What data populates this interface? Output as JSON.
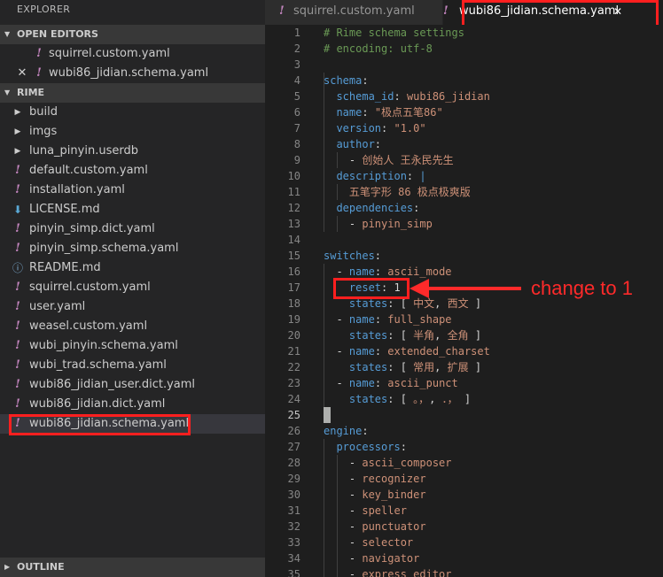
{
  "sidebar": {
    "title": "EXPLORER",
    "open_editors": {
      "label": "OPEN EDITORS",
      "items": [
        {
          "name": "squirrel.custom.yaml",
          "icon": "yaml-exclamation-icon"
        },
        {
          "name": "wubi86_jidian.schema.yaml",
          "icon": "yaml-exclamation-icon",
          "close_glyph": "✕"
        }
      ]
    },
    "folder": {
      "label": "RIME",
      "items": [
        {
          "name": "build",
          "icon": "chevron-right-icon"
        },
        {
          "name": "imgs",
          "icon": "chevron-right-icon"
        },
        {
          "name": "luna_pinyin.userdb",
          "icon": "chevron-right-icon"
        },
        {
          "name": "default.custom.yaml",
          "icon": "yaml-exclamation-icon"
        },
        {
          "name": "installation.yaml",
          "icon": "yaml-exclamation-icon"
        },
        {
          "name": "LICENSE.md",
          "icon": "download-arrow-icon"
        },
        {
          "name": "pinyin_simp.dict.yaml",
          "icon": "yaml-exclamation-icon"
        },
        {
          "name": "pinyin_simp.schema.yaml",
          "icon": "yaml-exclamation-icon"
        },
        {
          "name": "README.md",
          "icon": "info-icon"
        },
        {
          "name": "squirrel.custom.yaml",
          "icon": "yaml-exclamation-icon"
        },
        {
          "name": "user.yaml",
          "icon": "yaml-exclamation-icon"
        },
        {
          "name": "weasel.custom.yaml",
          "icon": "yaml-exclamation-icon"
        },
        {
          "name": "wubi_pinyin.schema.yaml",
          "icon": "yaml-exclamation-icon"
        },
        {
          "name": "wubi_trad.schema.yaml",
          "icon": "yaml-exclamation-icon"
        },
        {
          "name": "wubi86_jidian_user.dict.yaml",
          "icon": "yaml-exclamation-icon"
        },
        {
          "name": "wubi86_jidian.dict.yaml",
          "icon": "yaml-exclamation-icon"
        },
        {
          "name": "wubi86_jidian.schema.yaml",
          "icon": "yaml-exclamation-icon",
          "selected": true
        }
      ]
    },
    "outline_label": "OUTLINE"
  },
  "tabs": [
    {
      "label": "squirrel.custom.yaml",
      "active": false
    },
    {
      "label": "wubi86_jidian.schema.yaml",
      "active": true,
      "close_glyph": "✕"
    }
  ],
  "editor": {
    "active_line": 25,
    "lines": [
      {
        "n": "1",
        "tokens": [
          {
            "t": "# Rime schema settings",
            "c": "c"
          }
        ]
      },
      {
        "n": "2",
        "tokens": [
          {
            "t": "# encoding: utf-8",
            "c": "c"
          }
        ]
      },
      {
        "n": "3",
        "tokens": []
      },
      {
        "n": "4",
        "tokens": [
          {
            "t": "schema",
            "c": "k"
          },
          {
            "t": ":",
            "c": "p"
          }
        ]
      },
      {
        "n": "5",
        "tokens": [
          {
            "t": "  schema_id",
            "c": "k"
          },
          {
            "t": ": ",
            "c": "p"
          },
          {
            "t": "wubi86_jidian",
            "c": "s"
          }
        ]
      },
      {
        "n": "6",
        "tokens": [
          {
            "t": "  name",
            "c": "k"
          },
          {
            "t": ": ",
            "c": "p"
          },
          {
            "t": "\"极点五笔86\"",
            "c": "s"
          }
        ]
      },
      {
        "n": "7",
        "tokens": [
          {
            "t": "  version",
            "c": "k"
          },
          {
            "t": ": ",
            "c": "p"
          },
          {
            "t": "\"1.0\"",
            "c": "s"
          }
        ]
      },
      {
        "n": "8",
        "tokens": [
          {
            "t": "  author",
            "c": "k"
          },
          {
            "t": ":",
            "c": "p"
          }
        ]
      },
      {
        "n": "9",
        "tokens": [
          {
            "t": "    - ",
            "c": "p"
          },
          {
            "t": "创始人 王永民先生",
            "c": "s"
          }
        ]
      },
      {
        "n": "10",
        "tokens": [
          {
            "t": "  description",
            "c": "k"
          },
          {
            "t": ": ",
            "c": "p"
          },
          {
            "t": "|",
            "c": "k"
          }
        ]
      },
      {
        "n": "11",
        "tokens": [
          {
            "t": "    五笔字形 86 极点极爽版",
            "c": "s"
          }
        ]
      },
      {
        "n": "12",
        "tokens": [
          {
            "t": "  dependencies",
            "c": "k"
          },
          {
            "t": ":",
            "c": "p"
          }
        ]
      },
      {
        "n": "13",
        "tokens": [
          {
            "t": "    - ",
            "c": "p"
          },
          {
            "t": "pinyin_simp",
            "c": "s"
          }
        ]
      },
      {
        "n": "14",
        "tokens": []
      },
      {
        "n": "15",
        "tokens": [
          {
            "t": "switches",
            "c": "k"
          },
          {
            "t": ":",
            "c": "p"
          }
        ]
      },
      {
        "n": "16",
        "tokens": [
          {
            "t": "  - ",
            "c": "p"
          },
          {
            "t": "name",
            "c": "k"
          },
          {
            "t": ": ",
            "c": "p"
          },
          {
            "t": "ascii_mode",
            "c": "s"
          }
        ]
      },
      {
        "n": "17",
        "tokens": [
          {
            "t": "    reset",
            "c": "k"
          },
          {
            "t": ": ",
            "c": "p"
          },
          {
            "t": "1",
            "c": "p"
          }
        ]
      },
      {
        "n": "18",
        "tokens": [
          {
            "t": "    states",
            "c": "k"
          },
          {
            "t": ": [ ",
            "c": "p"
          },
          {
            "t": "中文",
            "c": "s"
          },
          {
            "t": ", ",
            "c": "p"
          },
          {
            "t": "西文",
            "c": "s"
          },
          {
            "t": " ]",
            "c": "p"
          }
        ]
      },
      {
        "n": "19",
        "tokens": [
          {
            "t": "  - ",
            "c": "p"
          },
          {
            "t": "name",
            "c": "k"
          },
          {
            "t": ": ",
            "c": "p"
          },
          {
            "t": "full_shape",
            "c": "s"
          }
        ]
      },
      {
        "n": "20",
        "tokens": [
          {
            "t": "    states",
            "c": "k"
          },
          {
            "t": ": [ ",
            "c": "p"
          },
          {
            "t": "半角",
            "c": "s"
          },
          {
            "t": ", ",
            "c": "p"
          },
          {
            "t": "全角",
            "c": "s"
          },
          {
            "t": " ]",
            "c": "p"
          }
        ]
      },
      {
        "n": "21",
        "tokens": [
          {
            "t": "  - ",
            "c": "p"
          },
          {
            "t": "name",
            "c": "k"
          },
          {
            "t": ": ",
            "c": "p"
          },
          {
            "t": "extended_charset",
            "c": "s"
          }
        ]
      },
      {
        "n": "22",
        "tokens": [
          {
            "t": "    states",
            "c": "k"
          },
          {
            "t": ": [ ",
            "c": "p"
          },
          {
            "t": "常用",
            "c": "s"
          },
          {
            "t": ", ",
            "c": "p"
          },
          {
            "t": "扩展",
            "c": "s"
          },
          {
            "t": " ]",
            "c": "p"
          }
        ]
      },
      {
        "n": "23",
        "tokens": [
          {
            "t": "  - ",
            "c": "p"
          },
          {
            "t": "name",
            "c": "k"
          },
          {
            "t": ": ",
            "c": "p"
          },
          {
            "t": "ascii_punct",
            "c": "s"
          }
        ]
      },
      {
        "n": "24",
        "tokens": [
          {
            "t": "    states",
            "c": "k"
          },
          {
            "t": ": [ ",
            "c": "p"
          },
          {
            "t": "。，",
            "c": "s"
          },
          {
            "t": ", ",
            "c": "p"
          },
          {
            "t": "．，",
            "c": "s"
          },
          {
            "t": " ]",
            "c": "p"
          }
        ]
      },
      {
        "n": "25",
        "tokens": []
      },
      {
        "n": "26",
        "tokens": [
          {
            "t": "engine",
            "c": "k"
          },
          {
            "t": ":",
            "c": "p"
          }
        ]
      },
      {
        "n": "27",
        "tokens": [
          {
            "t": "  processors",
            "c": "k"
          },
          {
            "t": ":",
            "c": "p"
          }
        ]
      },
      {
        "n": "28",
        "tokens": [
          {
            "t": "    - ",
            "c": "p"
          },
          {
            "t": "ascii_composer",
            "c": "s"
          }
        ]
      },
      {
        "n": "29",
        "tokens": [
          {
            "t": "    - ",
            "c": "p"
          },
          {
            "t": "recognizer",
            "c": "s"
          }
        ]
      },
      {
        "n": "30",
        "tokens": [
          {
            "t": "    - ",
            "c": "p"
          },
          {
            "t": "key_binder",
            "c": "s"
          }
        ]
      },
      {
        "n": "31",
        "tokens": [
          {
            "t": "    - ",
            "c": "p"
          },
          {
            "t": "speller",
            "c": "s"
          }
        ]
      },
      {
        "n": "32",
        "tokens": [
          {
            "t": "    - ",
            "c": "p"
          },
          {
            "t": "punctuator",
            "c": "s"
          }
        ]
      },
      {
        "n": "33",
        "tokens": [
          {
            "t": "    - ",
            "c": "p"
          },
          {
            "t": "selector",
            "c": "s"
          }
        ]
      },
      {
        "n": "34",
        "tokens": [
          {
            "t": "    - ",
            "c": "p"
          },
          {
            "t": "navigator",
            "c": "s"
          }
        ]
      },
      {
        "n": "35",
        "tokens": [
          {
            "t": "    - ",
            "c": "p"
          },
          {
            "t": "express_editor",
            "c": "s"
          }
        ]
      }
    ]
  },
  "annotation": {
    "text": "change to 1",
    "color": "#ff2a2a"
  },
  "colors": {
    "keyword": "#569cd6",
    "string": "#ce9178",
    "comment": "#6a9955",
    "yaml_icon": "#c586c0"
  }
}
